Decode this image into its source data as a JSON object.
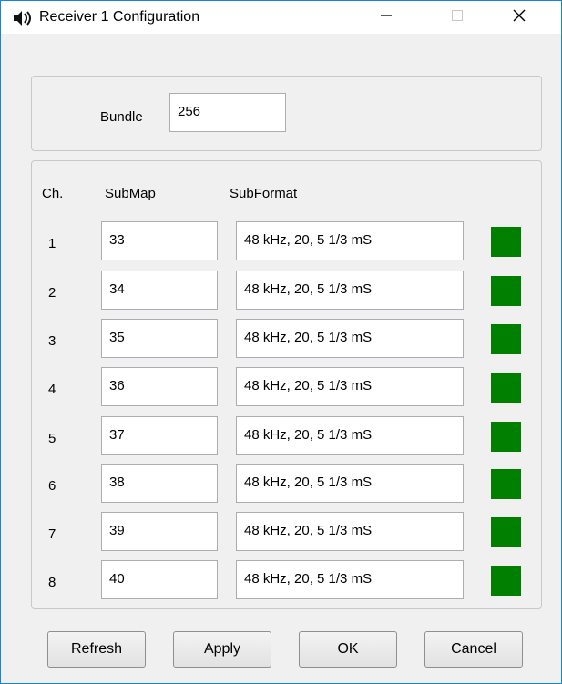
{
  "window": {
    "title": "Receiver 1 Configuration",
    "icon": "speaker-icon",
    "controls": {
      "minimize": "—",
      "maximize": "☐",
      "close": "✕"
    }
  },
  "bundle": {
    "label": "Bundle",
    "value": "256"
  },
  "table": {
    "headers": {
      "channel": "Ch.",
      "submap": "SubMap",
      "subformat": "SubFormat"
    },
    "rows": [
      {
        "ch": "1",
        "submap": "33",
        "subformat": "48 kHz, 20, 5 1/3 mS",
        "status": "ok"
      },
      {
        "ch": "2",
        "submap": "34",
        "subformat": "48 kHz, 20, 5 1/3 mS",
        "status": "ok"
      },
      {
        "ch": "3",
        "submap": "35",
        "subformat": "48 kHz, 20, 5 1/3 mS",
        "status": "ok"
      },
      {
        "ch": "4",
        "submap": "36",
        "subformat": "48 kHz, 20, 5 1/3 mS",
        "status": "ok"
      },
      {
        "ch": "5",
        "submap": "37",
        "subformat": "48 kHz, 20, 5 1/3 mS",
        "status": "ok"
      },
      {
        "ch": "6",
        "submap": "38",
        "subformat": "48 kHz, 20, 5 1/3 mS",
        "status": "ok"
      },
      {
        "ch": "7",
        "submap": "39",
        "subformat": "48 kHz, 20, 5 1/3 mS",
        "status": "ok"
      },
      {
        "ch": "8",
        "submap": "40",
        "subformat": "48 kHz, 20, 5 1/3 mS",
        "status": "ok"
      }
    ]
  },
  "colors": {
    "status_ok": "#007f00",
    "window_border": "#1883d7"
  },
  "buttons": {
    "refresh": "Refresh",
    "apply": "Apply",
    "ok": "OK",
    "cancel": "Cancel"
  }
}
